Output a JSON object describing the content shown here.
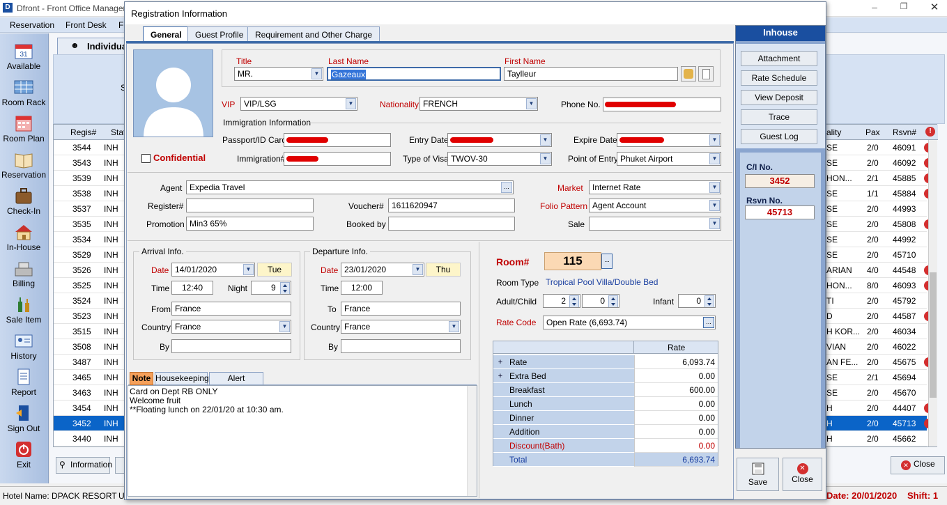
{
  "app": {
    "title": "Dfront - Front Office Manager",
    "menu": [
      "Reservation",
      "Front Desk",
      "Fr"
    ],
    "window_controls": [
      "minimize",
      "restore",
      "close"
    ]
  },
  "sidebar": {
    "items": [
      {
        "label": "Available",
        "icon": "calendar-icon"
      },
      {
        "label": "Room Rack",
        "icon": "room-rack-icon"
      },
      {
        "label": "Room Plan",
        "icon": "calendar-grid-icon"
      },
      {
        "label": "Reservation",
        "icon": "book-icon"
      },
      {
        "label": "Check-In",
        "icon": "suitcase-icon"
      },
      {
        "label": "In-House",
        "icon": "house-icon"
      },
      {
        "label": "Billing",
        "icon": "cash-register-icon"
      },
      {
        "label": "Sale Item",
        "icon": "bottles-icon"
      },
      {
        "label": "History",
        "icon": "id-card-icon"
      },
      {
        "label": "Report",
        "icon": "report-icon"
      },
      {
        "label": "Sign Out",
        "icon": "sign-out-icon"
      },
      {
        "label": "Exit",
        "icon": "power-icon"
      }
    ]
  },
  "background": {
    "tab_label": "Individua",
    "search_letter": "S",
    "table": {
      "left_headers": [
        "Regis#",
        "Stat"
      ],
      "right_headers": [
        "ality",
        "Pax",
        "Rsvn#"
      ],
      "rows": [
        {
          "regis": "3544",
          "stat": "INH",
          "nat": "SE",
          "pax": "2/0",
          "rsvn": "46091",
          "flag": true
        },
        {
          "regis": "3543",
          "stat": "INH",
          "nat": "SE",
          "pax": "2/0",
          "rsvn": "46092",
          "flag": true
        },
        {
          "regis": "3539",
          "stat": "INH",
          "nat": "HON...",
          "pax": "2/1",
          "rsvn": "45885",
          "flag": true
        },
        {
          "regis": "3538",
          "stat": "INH",
          "nat": "SE",
          "pax": "1/1",
          "rsvn": "45884",
          "flag": true
        },
        {
          "regis": "3537",
          "stat": "INH",
          "nat": "SE",
          "pax": "2/0",
          "rsvn": "44993",
          "flag": false
        },
        {
          "regis": "3535",
          "stat": "INH",
          "nat": "SE",
          "pax": "2/0",
          "rsvn": "45808",
          "flag": true
        },
        {
          "regis": "3534",
          "stat": "INH",
          "nat": "SE",
          "pax": "2/0",
          "rsvn": "44992",
          "flag": false
        },
        {
          "regis": "3529",
          "stat": "INH",
          "nat": "SE",
          "pax": "2/0",
          "rsvn": "45710",
          "flag": false
        },
        {
          "regis": "3526",
          "stat": "INH",
          "nat": "ARIAN",
          "pax": "4/0",
          "rsvn": "44548",
          "flag": true
        },
        {
          "regis": "3525",
          "stat": "INH",
          "nat": "HON...",
          "pax": "8/0",
          "rsvn": "46093",
          "flag": true
        },
        {
          "regis": "3524",
          "stat": "INH",
          "nat": "TI",
          "pax": "2/0",
          "rsvn": "45792",
          "flag": false
        },
        {
          "regis": "3523",
          "stat": "INH",
          "nat": "D",
          "pax": "2/0",
          "rsvn": "44587",
          "flag": true
        },
        {
          "regis": "3515",
          "stat": "INH",
          "nat": "H KOR...",
          "pax": "2/0",
          "rsvn": "46034",
          "flag": false
        },
        {
          "regis": "3508",
          "stat": "INH",
          "nat": "VIAN",
          "pax": "2/0",
          "rsvn": "46022",
          "flag": false
        },
        {
          "regis": "3487",
          "stat": "INH",
          "nat": "AN FE...",
          "pax": "2/0",
          "rsvn": "45675",
          "flag": true
        },
        {
          "regis": "3465",
          "stat": "INH",
          "nat": "SE",
          "pax": "2/1",
          "rsvn": "45694",
          "flag": false
        },
        {
          "regis": "3463",
          "stat": "INH",
          "nat": "SE",
          "pax": "2/0",
          "rsvn": "45670",
          "flag": false
        },
        {
          "regis": "3454",
          "stat": "INH",
          "nat": "H",
          "pax": "2/0",
          "rsvn": "44407",
          "flag": true
        },
        {
          "regis": "3452",
          "stat": "INH",
          "nat": "H",
          "pax": "2/0",
          "rsvn": "45713",
          "flag": true,
          "selected": true
        },
        {
          "regis": "3440",
          "stat": "INH",
          "nat": "H",
          "pax": "2/0",
          "rsvn": "45662",
          "flag": false
        }
      ]
    },
    "information_button": "Information",
    "close_button": "Close",
    "status_bar": {
      "hotel": "Hotel Name: DPACK RESORT",
      "u": "U",
      "date": "Date: 20/01/2020",
      "shift": "Shift: 1"
    }
  },
  "dialog": {
    "title": "Registration Information",
    "tabs": [
      "General",
      "Guest Profile",
      "Requirement and Other Charge"
    ],
    "guest": {
      "title_label": "Title",
      "title_value": "MR.",
      "last_name_label": "Last Name",
      "last_name_value": "Gazeaux",
      "first_name_label": "First Name",
      "first_name_value": "Taylleur",
      "vip_label": "VIP",
      "vip_value": "VIP/LSG",
      "nationality_label": "Nationality",
      "nationality_value": "FRENCH",
      "phone_label": "Phone No.",
      "confidential_label": "Confidential",
      "immigration_section": "Immigration Information",
      "passport_label": "Passport/ID Card",
      "entry_date_label": "Entry Date",
      "expire_date_label": "Expire Date",
      "immigration_label": "Immigration#",
      "visa_label": "Type of Visa",
      "visa_value": "TWOV-30",
      "point_entry_label": "Point of Entry",
      "point_entry_value": "Phuket Airport"
    },
    "booking": {
      "agent_label": "Agent",
      "agent_value": "Expedia Travel",
      "market_label": "Market",
      "market_value": "Internet Rate",
      "register_label": "Register#",
      "voucher_label": "Voucher#",
      "voucher_value": "1611620947",
      "folio_label": "Folio Pattern",
      "folio_value": "Agent Account",
      "promotion_label": "Promotion",
      "promotion_value": "Min3 65%",
      "booked_by_label": "Booked by",
      "sale_label": "Sale"
    },
    "arrival": {
      "group_label": "Arrival Info.",
      "date_label": "Date",
      "date_value": "14/01/2020",
      "day": "Tue",
      "time_label": "Time",
      "time_value": "12:40",
      "night_label": "Night",
      "night_value": "9",
      "from_label": "From",
      "from_value": "France",
      "country_label": "Country",
      "country_value": "France",
      "by_label": "By"
    },
    "departure": {
      "group_label": "Departure Info.",
      "date_label": "Date",
      "date_value": "23/01/2020",
      "day": "Thu",
      "time_label": "Time",
      "time_value": "12:00",
      "to_label": "To",
      "to_value": "France",
      "country_label": "Country",
      "country_value": "France",
      "by_label": "By"
    },
    "room": {
      "room_label": "Room#",
      "room_value": "115",
      "room_type_label": "Room Type",
      "room_type_value": "Tropical Pool Villa/Double Bed",
      "adult_child_label": "Adult/Child",
      "adult_value": "2",
      "child_value": "0",
      "infant_label": "Infant",
      "infant_value": "0",
      "rate_code_label": "Rate Code",
      "rate_code_value": "Open Rate (6,693.74)"
    },
    "rate_table": {
      "header": "Rate",
      "rows": [
        {
          "expand": "+",
          "label": "Rate",
          "value": "6,093.74",
          "style": "normal"
        },
        {
          "expand": "+",
          "label": "Extra Bed",
          "value": "0.00",
          "style": "normal"
        },
        {
          "expand": "",
          "label": "Breakfast",
          "value": "600.00",
          "style": "normal"
        },
        {
          "expand": "",
          "label": "Lunch",
          "value": "0.00",
          "style": "normal"
        },
        {
          "expand": "",
          "label": "Dinner",
          "value": "0.00",
          "style": "normal"
        },
        {
          "expand": "",
          "label": "Addition",
          "value": "0.00",
          "style": "normal"
        },
        {
          "expand": "",
          "label": "Discount(Bath)",
          "value": "0.00",
          "style": "discount"
        },
        {
          "expand": "",
          "label": "Total",
          "value": "6,693.74",
          "style": "total"
        }
      ]
    },
    "note_tabs": [
      "Note",
      "Housekeeping",
      "Alert Message"
    ],
    "note_lines": [
      "Card on Dept RB ONLY",
      "Welcome fruit",
      "**Floating lunch on 22/01/20 at 10:30 am."
    ],
    "right_panel": {
      "header": "Inhouse",
      "buttons": [
        "Attachment",
        "Rate Schedule",
        "View Deposit",
        "Trace",
        "Guest Log"
      ],
      "ci_label": "C/I No.",
      "ci_value": "3452",
      "rsvn_label": "Rsvn No.",
      "rsvn_value": "45713",
      "save_label": "Save",
      "close_label": "Close"
    }
  },
  "colors": {
    "accent_blue": "#1a4fa0",
    "panel_blue": "#8aa5cf",
    "selected_row": "#0a64c8",
    "label_red": "#c00000",
    "redaction_red": "#e00000"
  }
}
